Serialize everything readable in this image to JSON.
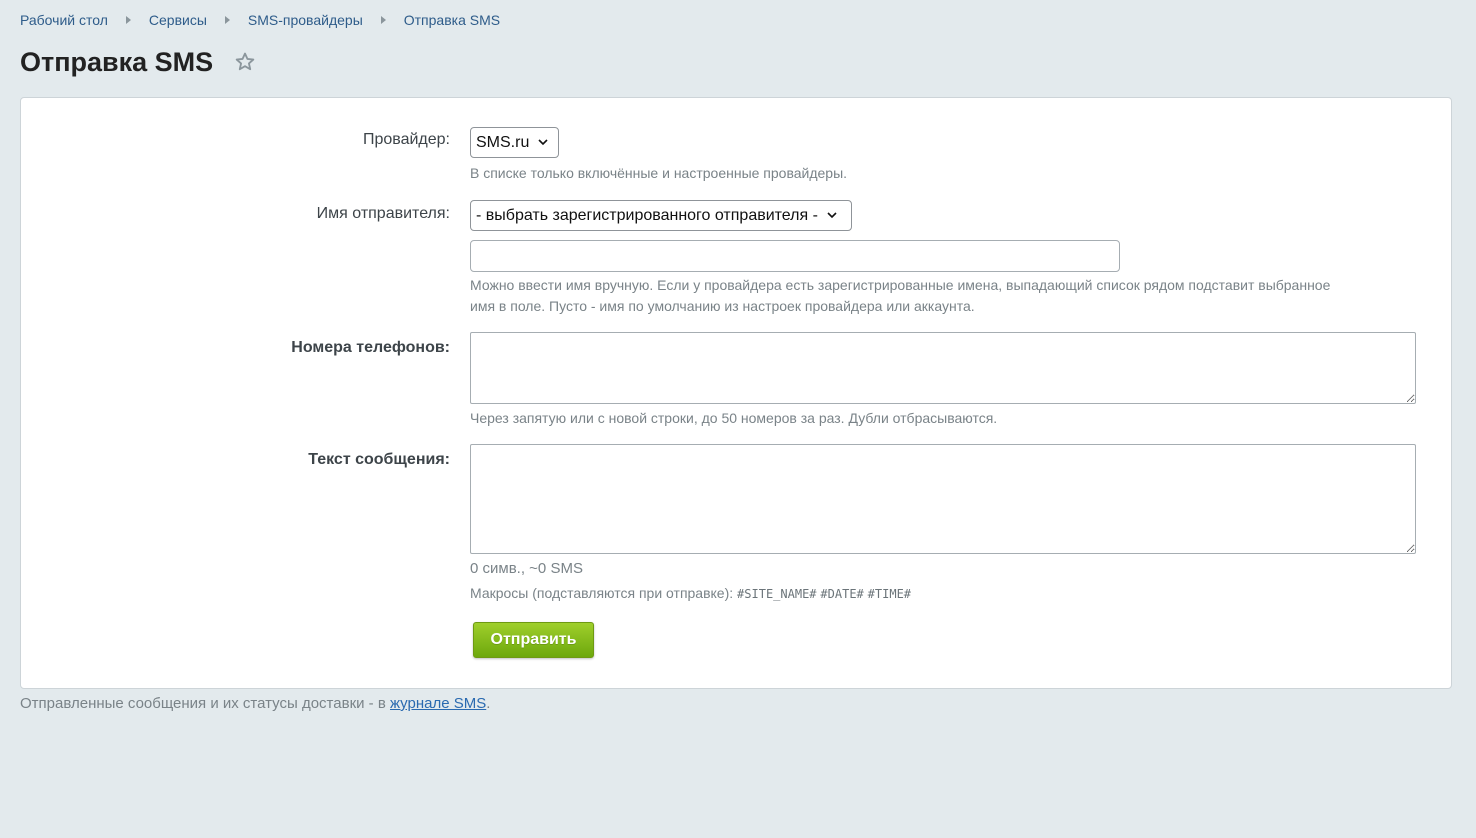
{
  "breadcrumb": {
    "items": [
      "Рабочий стол",
      "Сервисы",
      "SMS-провайдеры",
      "Отправка SMS"
    ]
  },
  "page": {
    "title": "Отправка SMS",
    "favorite_icon": "star-outline-icon"
  },
  "form": {
    "provider": {
      "label": "Провайдер:",
      "selected": "SMS.ru",
      "hint": "В списке только включённые и настроенные провайдеры."
    },
    "sender": {
      "label": "Имя отправителя:",
      "selected": "- выбрать зарегистрированного отправителя -",
      "value": "",
      "hint_line1": "Можно ввести имя вручную. Если у провайдера есть зарегистрированные имена, выпадающий список рядом подставит выбранное",
      "hint_line2": "имя в поле. Пусто - имя по умолчанию из настроек провайдера или аккаунта."
    },
    "phones": {
      "label": "Номера телефонов:",
      "value": "",
      "hint": "Через запятую или с новой строки, до 50 номеров за раз. Дубли отбрасываются."
    },
    "message": {
      "label": "Текст сообщения:",
      "value": "",
      "counter": "0 симв., ~0 SMS",
      "macros_label": "Макросы (подставляются при отправке):",
      "macros": [
        "#SITE_NAME#",
        "#DATE#",
        "#TIME#"
      ]
    },
    "submit_label": "Отправить"
  },
  "footer": {
    "text": "Отправленные сообщения и их статусы доставки - в",
    "link_text": "журнале SMS",
    "suffix": "."
  },
  "colors": {
    "background": "#e3eaed",
    "link": "#2e5c8a",
    "button_green": "#86bb1c"
  }
}
